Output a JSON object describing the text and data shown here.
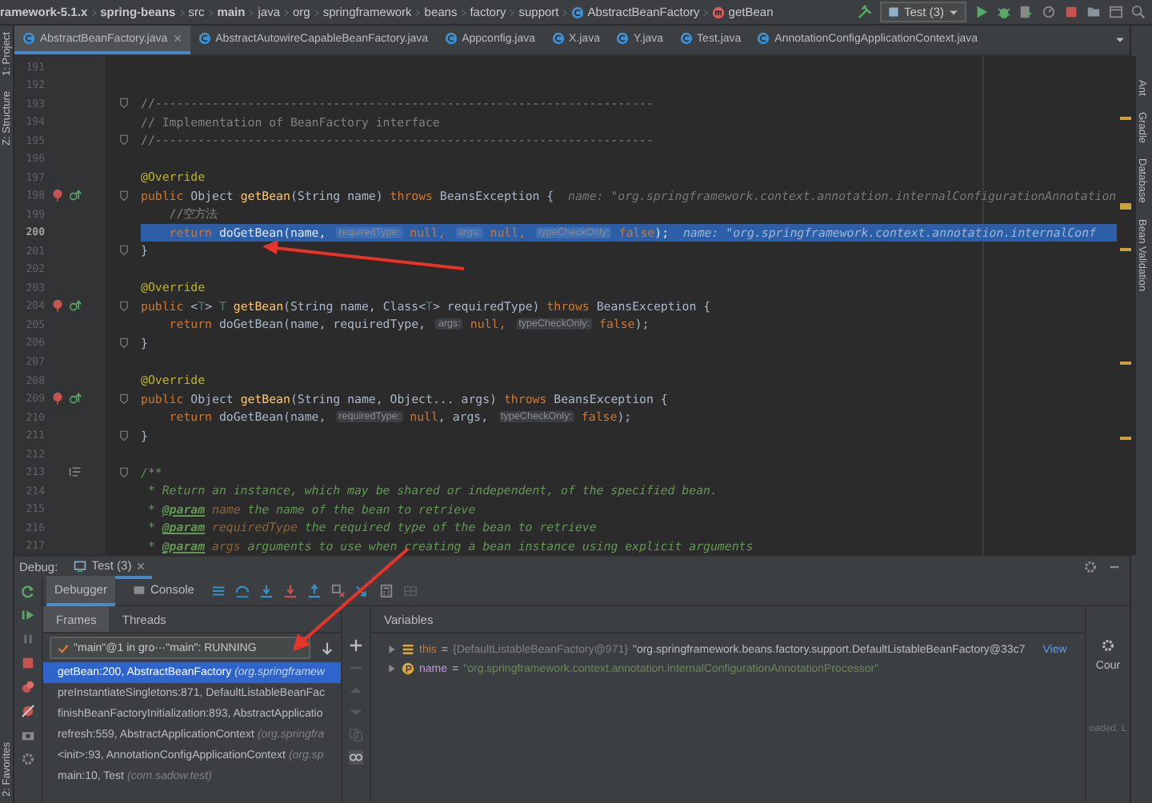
{
  "breadcrumb": [
    {
      "text": "ramework-5.1.x",
      "bold": true
    },
    {
      "text": "spring-beans",
      "bold": true
    },
    {
      "text": "src",
      "bold": false
    },
    {
      "text": "main",
      "bold": true
    },
    {
      "text": "java",
      "bold": false
    },
    {
      "text": "org",
      "bold": false
    },
    {
      "text": "springframework",
      "bold": false
    },
    {
      "text": "beans",
      "bold": false
    },
    {
      "text": "factory",
      "bold": false
    },
    {
      "text": "support",
      "bold": false
    },
    {
      "text": "AbstractBeanFactory",
      "bold": false,
      "kind": "class"
    },
    {
      "text": "getBean",
      "bold": false,
      "kind": "method"
    }
  ],
  "run_config": "Test (3)",
  "left_strip": [
    "1: Project",
    "Z: Structure",
    "2: Favorites"
  ],
  "right_strip": [
    "Ant",
    "Gradle",
    "Database",
    "Bean Validation"
  ],
  "tabs": [
    {
      "label": "AbstractBeanFactory.java",
      "selected": true
    },
    {
      "label": "AbstractAutowireCapableBeanFactory.java",
      "selected": false
    },
    {
      "label": "Appconfig.java",
      "selected": false
    },
    {
      "label": "X.java",
      "selected": false
    },
    {
      "label": "Y.java",
      "selected": false
    },
    {
      "label": "Test.java",
      "selected": false
    },
    {
      "label": "AnnotationConfigApplicationContext.java",
      "selected": false
    }
  ],
  "code": [
    {
      "no": "191",
      "current": false,
      "fold": false
    },
    {
      "no": "192",
      "current": false,
      "fold": false
    },
    {
      "no": "193",
      "current": false,
      "fold": true,
      "tokens": [
        {
          "kind": "comment",
          "text": "//----------------------------------------------------------------------"
        }
      ]
    },
    {
      "no": "194",
      "current": false,
      "fold": false,
      "tokens": [
        {
          "kind": "comment",
          "text": "// Implementation of BeanFactory interface"
        }
      ]
    },
    {
      "no": "195",
      "current": false,
      "fold": true,
      "tokens": [
        {
          "kind": "comment",
          "text": "//----------------------------------------------------------------------"
        }
      ]
    },
    {
      "no": "196",
      "current": false,
      "fold": false
    },
    {
      "no": "197",
      "current": false,
      "fold": false,
      "tokens": [
        {
          "kind": "ann",
          "text": "@Override"
        }
      ]
    },
    {
      "no": "198",
      "current": false,
      "fold": true,
      "kind": "override",
      "tokens": [
        {
          "kind": "kw",
          "text": "public "
        },
        {
          "kind": "plain",
          "text": "Object "
        },
        {
          "kind": "fn",
          "text": "getBean"
        },
        {
          "kind": "plain",
          "text": "(String name) "
        },
        {
          "kind": "kw",
          "text": "throws "
        },
        {
          "kind": "plain",
          "text": "BeansException {  "
        },
        {
          "kind": "val",
          "text": "name: \"org.springframework.context.annotation.internalConfigurationAnnotation"
        }
      ]
    },
    {
      "no": "199",
      "current": false,
      "fold": false,
      "tokens": [
        {
          "kind": "comment",
          "text": "    //空方法"
        }
      ]
    },
    {
      "no": "200",
      "current": true,
      "fold": false,
      "tokens": [
        {
          "kind": "kw",
          "text": "    return "
        },
        {
          "kind": "plain",
          "text": "doGetBean(name, "
        },
        {
          "kind": "hint",
          "text": "requiredType:"
        },
        {
          "kind": "kw",
          "text": " null, "
        },
        {
          "kind": "hint",
          "text": "args:"
        },
        {
          "kind": "kw",
          "text": " null, "
        },
        {
          "kind": "hint",
          "text": "typeCheckOnly:"
        },
        {
          "kind": "kw",
          "text": " false"
        },
        {
          "kind": "plain",
          "text": ");  "
        },
        {
          "kind": "val",
          "text": "name: \"org.springframework.context.annotation.internalConf"
        }
      ]
    },
    {
      "no": "201",
      "current": false,
      "fold": true,
      "tokens": [
        {
          "kind": "plain",
          "text": "}"
        }
      ]
    },
    {
      "no": "202",
      "current": false,
      "fold": false
    },
    {
      "no": "203",
      "current": false,
      "fold": false,
      "tokens": [
        {
          "kind": "ann",
          "text": "@Override"
        }
      ]
    },
    {
      "no": "204",
      "current": false,
      "fold": true,
      "kind": "override",
      "tokens": [
        {
          "kind": "kw",
          "text": "public "
        },
        {
          "kind": "plain",
          "text": "<"
        },
        {
          "kind": "type",
          "text": "T"
        },
        {
          "kind": "plain",
          "text": "> "
        },
        {
          "kind": "type",
          "text": "T "
        },
        {
          "kind": "fn",
          "text": "getBean"
        },
        {
          "kind": "plain",
          "text": "(String name, Class<"
        },
        {
          "kind": "type",
          "text": "T"
        },
        {
          "kind": "plain",
          "text": "> requiredType) "
        },
        {
          "kind": "kw",
          "text": "throws "
        },
        {
          "kind": "plain",
          "text": "BeansException {"
        }
      ]
    },
    {
      "no": "205",
      "current": false,
      "fold": false,
      "tokens": [
        {
          "kind": "kw",
          "text": "    return "
        },
        {
          "kind": "plain",
          "text": "doGetBean(name, requiredType, "
        },
        {
          "kind": "hint",
          "text": "args:"
        },
        {
          "kind": "kw",
          "text": " null, "
        },
        {
          "kind": "hint",
          "text": "typeCheckOnly:"
        },
        {
          "kind": "kw",
          "text": " false"
        },
        {
          "kind": "plain",
          "text": ");"
        }
      ]
    },
    {
      "no": "206",
      "current": false,
      "fold": true,
      "tokens": [
        {
          "kind": "plain",
          "text": "}"
        }
      ]
    },
    {
      "no": "207",
      "current": false,
      "fold": false
    },
    {
      "no": "208",
      "current": false,
      "fold": false,
      "tokens": [
        {
          "kind": "ann",
          "text": "@Override"
        }
      ]
    },
    {
      "no": "209",
      "current": false,
      "fold": true,
      "kind": "override",
      "tokens": [
        {
          "kind": "kw",
          "text": "public "
        },
        {
          "kind": "plain",
          "text": "Object "
        },
        {
          "kind": "fn",
          "text": "getBean"
        },
        {
          "kind": "plain",
          "text": "(String name, Object... args) "
        },
        {
          "kind": "kw",
          "text": "throws "
        },
        {
          "kind": "plain",
          "text": "BeansException {"
        }
      ]
    },
    {
      "no": "210",
      "current": false,
      "fold": false,
      "tokens": [
        {
          "kind": "kw",
          "text": "    return "
        },
        {
          "kind": "plain",
          "text": "doGetBean(name, "
        },
        {
          "kind": "hint",
          "text": "requiredType:"
        },
        {
          "kind": "kw",
          "text": " null"
        },
        {
          "kind": "plain",
          "text": ", args, "
        },
        {
          "kind": "hint",
          "text": "typeCheckOnly:"
        },
        {
          "kind": "kw",
          "text": " false"
        },
        {
          "kind": "plain",
          "text": ");"
        }
      ]
    },
    {
      "no": "211",
      "current": false,
      "fold": true,
      "tokens": [
        {
          "kind": "plain",
          "text": "}"
        }
      ]
    },
    {
      "no": "212",
      "current": false,
      "fold": false
    },
    {
      "no": "213",
      "current": false,
      "fold": true,
      "kind": "doc",
      "tokens": [
        {
          "kind": "doc",
          "text": "/**"
        }
      ]
    },
    {
      "no": "214",
      "current": false,
      "fold": false,
      "tokens": [
        {
          "kind": "doc",
          "text": " * Return an instance, which may be shared or independent, of the specified bean."
        }
      ]
    },
    {
      "no": "215",
      "current": false,
      "fold": false,
      "tokens": [
        {
          "kind": "doc",
          "text": " * "
        },
        {
          "kind": "tag",
          "text": "@param"
        },
        {
          "kind": "docname",
          "text": " name"
        },
        {
          "kind": "doc",
          "text": " the name of the bean to retrieve"
        }
      ]
    },
    {
      "no": "216",
      "current": false,
      "fold": false,
      "tokens": [
        {
          "kind": "doc",
          "text": " * "
        },
        {
          "kind": "tag",
          "text": "@param"
        },
        {
          "kind": "docname",
          "text": " requiredType"
        },
        {
          "kind": "doc",
          "text": " the required type of the bean to retrieve"
        }
      ]
    },
    {
      "no": "217",
      "current": false,
      "fold": false,
      "tokens": [
        {
          "kind": "doc",
          "text": " * "
        },
        {
          "kind": "tag",
          "text": "@param"
        },
        {
          "kind": "docname",
          "text": " args"
        },
        {
          "kind": "doc",
          "text": " arguments to use when creating a bean instance using explicit arguments"
        }
      ]
    }
  ],
  "debug": {
    "label": "Debug:",
    "session": "Test (3)",
    "tabs": [
      {
        "label": "Debugger",
        "selected": true
      },
      {
        "label": "Console",
        "selected": false
      }
    ],
    "frame_tabs": [
      {
        "label": "Frames",
        "selected": true
      },
      {
        "label": "Threads",
        "selected": false
      }
    ],
    "thread": "\"main\"@1 in gro···\"main\": RUNNING",
    "frames": [
      {
        "method": "getBean:200, AbstractBeanFactory",
        "pkg": "(org.springframew",
        "selected": true
      },
      {
        "method": "preInstantiateSingletons:871, DefaultListableBeanFac",
        "selected": false
      },
      {
        "method": "finishBeanFactoryInitialization:893, AbstractApplicatio",
        "selected": false
      },
      {
        "method": "refresh:559, AbstractApplicationContext",
        "pkg": "(org.springfra",
        "selected": false
      },
      {
        "method": "<init>:93, AnnotationConfigApplicationContext",
        "pkg": "(org.sp",
        "selected": false
      },
      {
        "method": "main:10, Test",
        "pkg": "(com.sadow.test)",
        "selected": false
      }
    ],
    "variables_title": "Variables",
    "variables": [
      {
        "kind": "field",
        "name": "this",
        "operator": "=",
        "type": "{DefaultListableBeanFactory@971}",
        "value": "\"org.springframework.beans.factory.support.DefaultListableBeanFactory@33c7",
        "link": "View"
      },
      {
        "kind": "param",
        "name": "name",
        "operator": "=",
        "value": "\"org.springframework.context.annotation.internalConfigurationAnnotationProcessor\""
      }
    ],
    "side_panel": {
      "label": "Cour",
      "status": "oaded. L"
    }
  }
}
